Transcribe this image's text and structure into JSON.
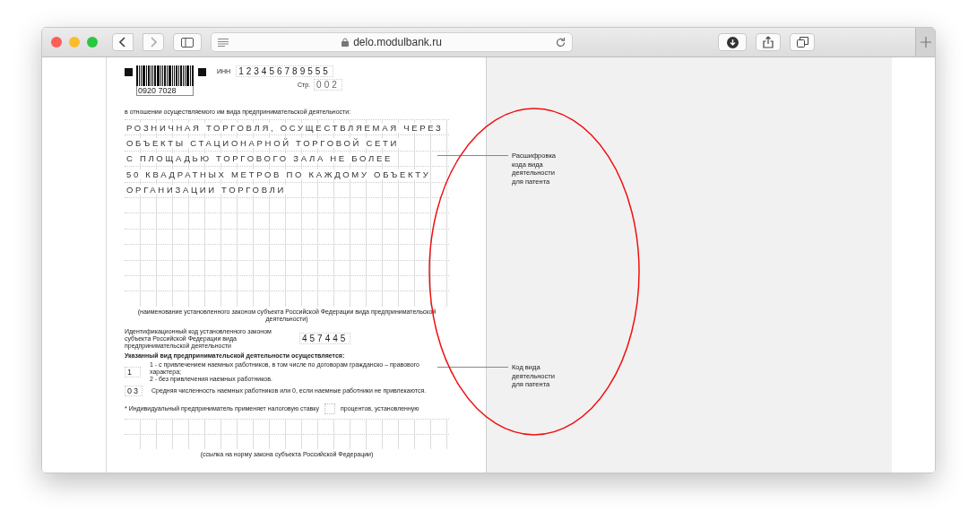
{
  "browser": {
    "url": "delo.modulbank.ru"
  },
  "form": {
    "barcode_number": "0920 7028",
    "inn_label": "ИНН",
    "inn": "123456789555",
    "page_label": "Стр.",
    "page": "002",
    "intro": "в отношении осуществляемого им вида предпринимательской деятельности:",
    "activity_lines": [
      "РОЗНИЧНАЯ ТОРГОВЛЯ, ОСУЩЕСТВЛЯЕМАЯ ЧЕРЕЗ",
      "ОБЪЕКТЫ СТАЦИОНАРНОЙ ТОРГОВОЙ СЕТИ",
      "С ПЛОЩАДЬЮ ТОРГОВОГО ЗАЛА НЕ БОЛЕЕ",
      "50 КВАДРАТНЫХ МЕТРОВ ПО КАЖДОМУ ОБЪЕКТУ",
      "ОРГАНИЗАЦИИ ТОРГОВЛИ"
    ],
    "activity_caption": "(наименование установленного законом субъекта Российской Федерации вида предпринимательской деятельности)",
    "id_code_label": "Идентификационный код установленного законом субъекта Российской Федерации вида предпринимательской деятельности",
    "id_code": "457445",
    "section_heading": "Указанный вид предпринимательской деятельности осуществляется:",
    "workers_flag": "1",
    "workers_options": [
      "1 - с привлечением наемных работников, в том числе по договорам гражданско – правового характера;",
      "2 - без привлечения наемных работников."
    ],
    "avg_workers": "03",
    "avg_workers_label": "Средняя численность наемных работников или 0, если наемные работники не привлекаются.",
    "tax_label": "* Индивидуальный предприниматель применяет налоговую ставку",
    "tax_suffix": "процентов, установленную",
    "law_caption": "(ссылка на норму закона субъекта Российской Федерации)"
  },
  "annotations": [
    {
      "text": "Расшифровка кода вида деятельности для патента"
    },
    {
      "text": "Код вида деятельности для патента"
    }
  ]
}
